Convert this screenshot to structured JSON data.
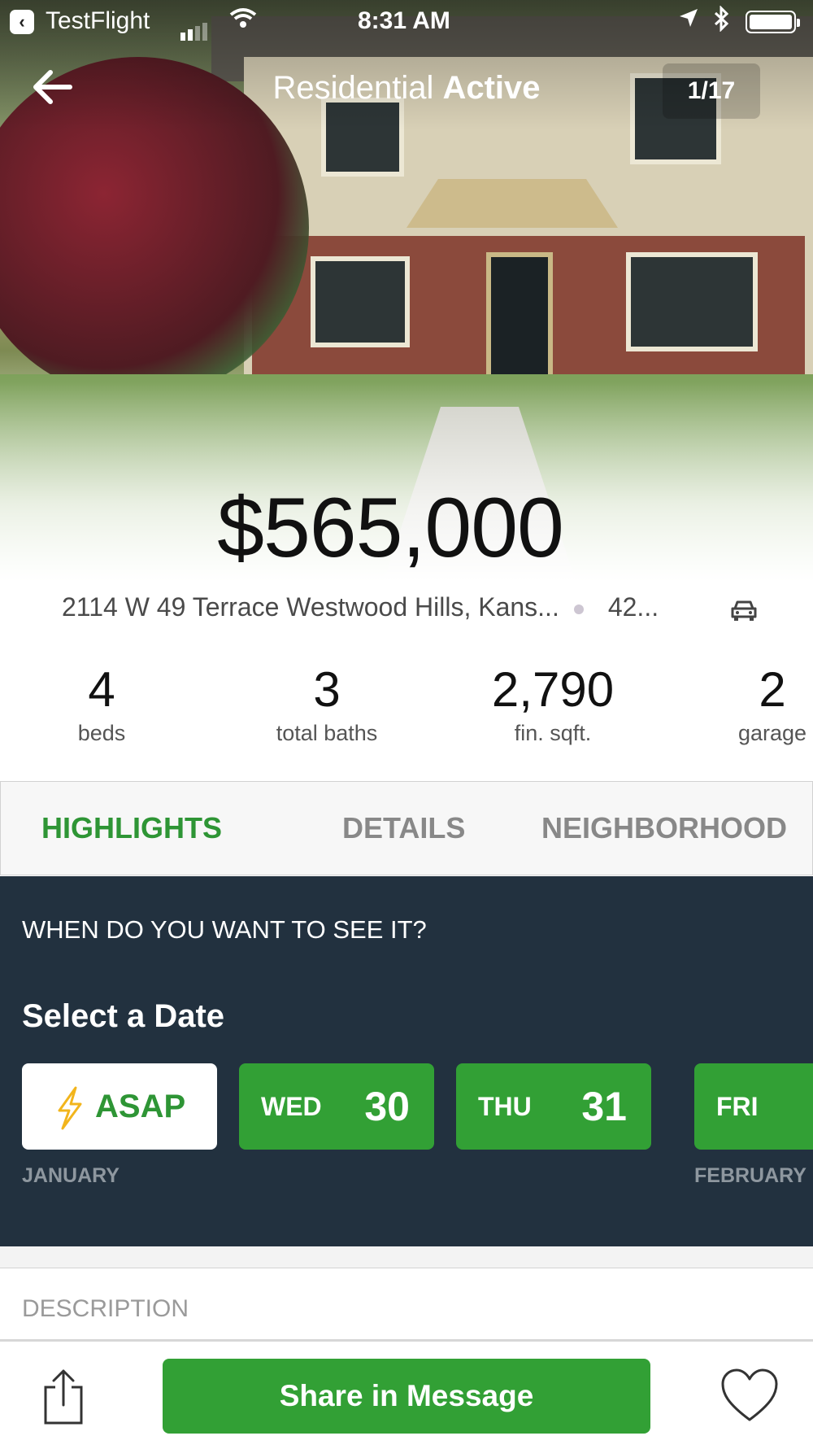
{
  "status_bar": {
    "back_app": "TestFlight",
    "time": "8:31 AM"
  },
  "nav": {
    "title_light": "Residential",
    "title_bold": "Active",
    "photo_counter": "1/17"
  },
  "listing": {
    "price": "$565,000",
    "address": "2114 W 49 Terrace Westwood Hills, Kans...",
    "commute": "42..."
  },
  "stats": [
    {
      "value": "4",
      "label": "beds"
    },
    {
      "value": "3",
      "label": "total baths"
    },
    {
      "value": "2,790",
      "label": "fin. sqft."
    },
    {
      "value": "2",
      "label": "garage"
    }
  ],
  "tabs": [
    {
      "label": "HIGHLIGHTS",
      "active": true
    },
    {
      "label": "DETAILS",
      "active": false
    },
    {
      "label": "NEIGHBORHOOD",
      "active": false
    }
  ],
  "booking": {
    "question": "WHEN DO YOU WANT TO SEE IT?",
    "select_label": "Select a Date",
    "asap_label": "ASAP",
    "dates": [
      {
        "dow": "WED",
        "day": "30"
      },
      {
        "dow": "THU",
        "day": "31"
      },
      {
        "dow": "FRI",
        "day": ""
      }
    ],
    "months": [
      "JANUARY",
      "FEBRUARY"
    ]
  },
  "description_header": "DESCRIPTION",
  "bottom_bar": {
    "share_button": "Share in Message"
  },
  "colors": {
    "accent_green": "#32a035",
    "active_tab_green": "#2e9535",
    "booking_bg": "#22313f",
    "bolt_yellow": "#f2b51c"
  },
  "icons": [
    "back-arrow-icon",
    "wifi-icon",
    "location-arrow-icon",
    "bluetooth-icon",
    "battery-icon",
    "car-icon",
    "lightning-bolt-icon",
    "share-icon",
    "heart-icon"
  ]
}
